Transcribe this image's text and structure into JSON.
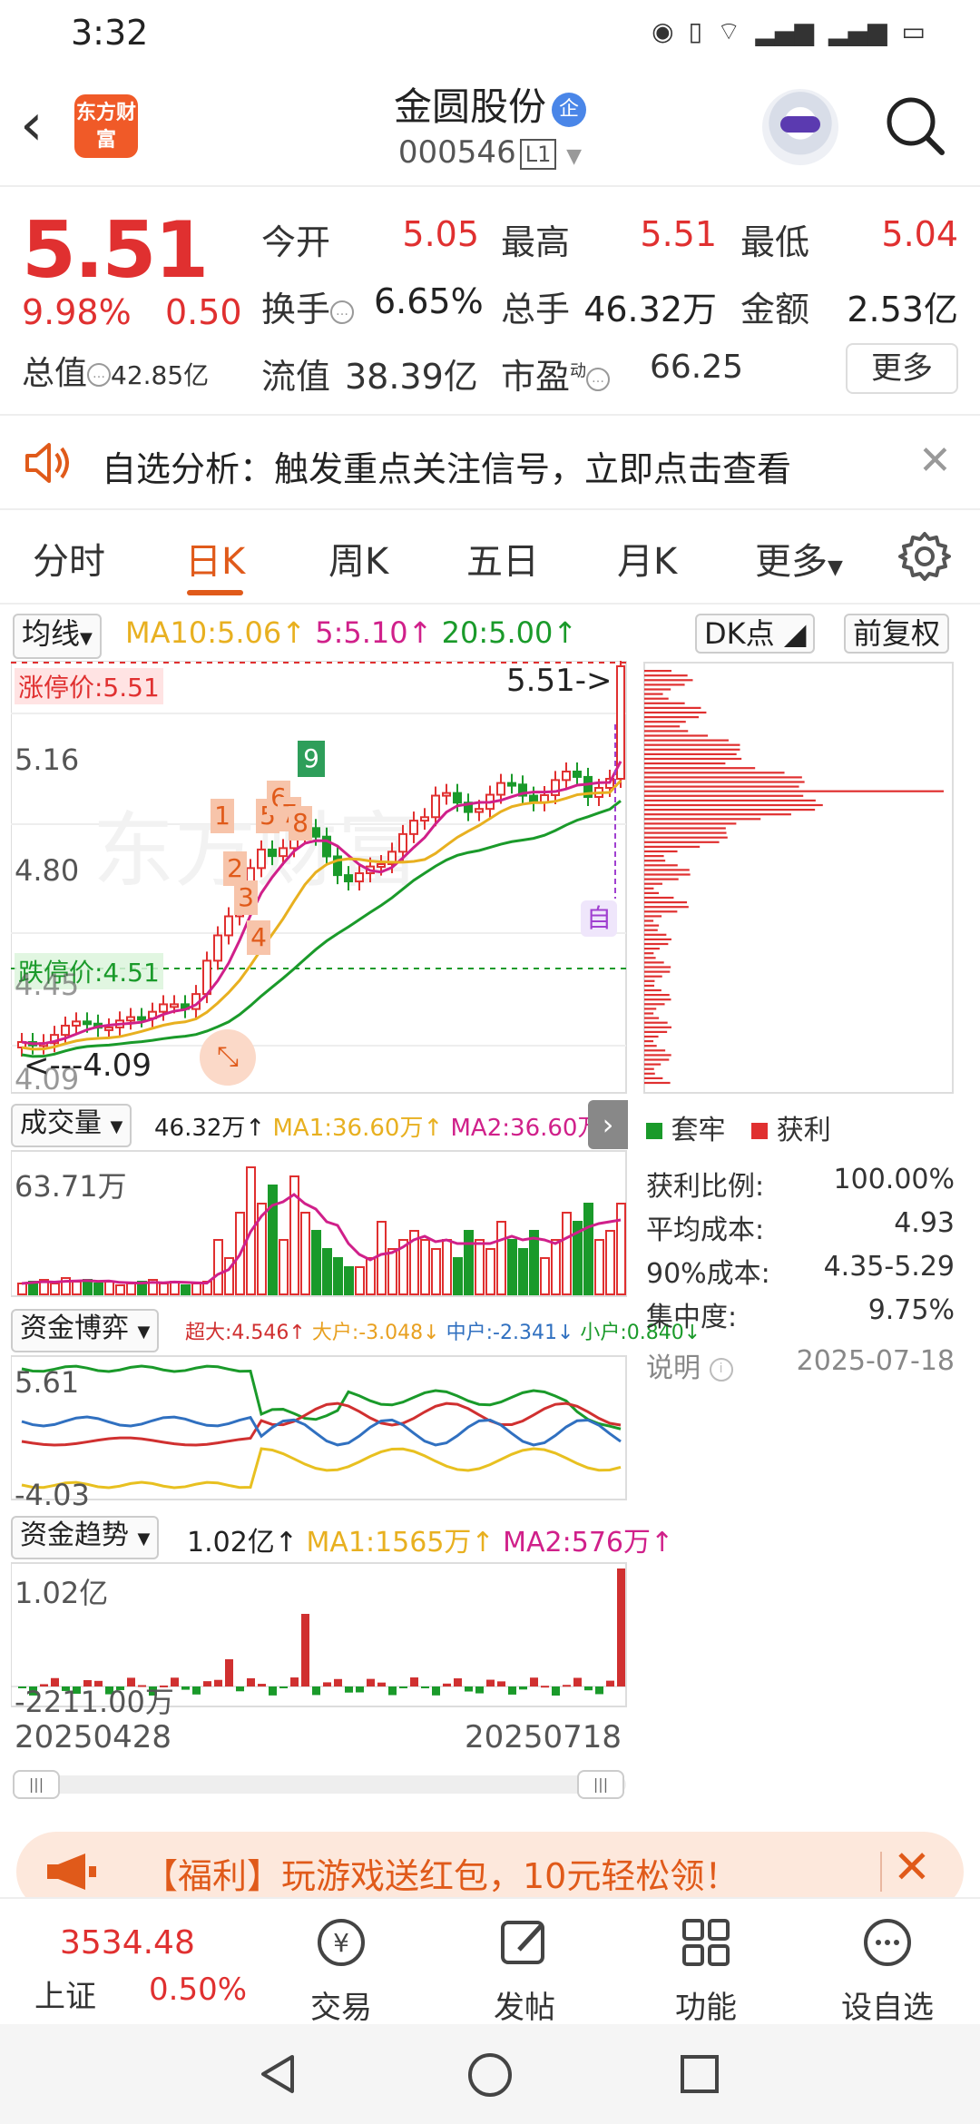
{
  "status": {
    "time": "3:32"
  },
  "header": {
    "title": "金圆股份",
    "badge": "企",
    "code": "000546",
    "code_tag": "L1",
    "logo_text": "东方财富"
  },
  "quote": {
    "price": "5.51",
    "pct": "9.98%",
    "change": "0.50",
    "open_label": "今开",
    "open": "5.05",
    "high_label": "最高",
    "high": "5.51",
    "low_label": "最低",
    "low": "5.04",
    "turnover_label": "换手",
    "turnover": "6.65%",
    "volume_label": "总手",
    "volume": "46.32万",
    "amount_label": "金额",
    "amount": "2.53亿",
    "total_value_label": "总值",
    "total_value": "42.85亿",
    "float_value_label": "流值",
    "float_value": "38.39亿",
    "pe_label": "市盈",
    "pe_sup": "动",
    "pe": "66.25",
    "more_button": "更多"
  },
  "notice": {
    "text": "自选分析：触发重点关注信号，立即点击查看"
  },
  "tabs": [
    "分时",
    "日K",
    "周K",
    "五日",
    "月K",
    "更多"
  ],
  "chart": {
    "ma_button": "均线",
    "ma10": "MA10:5.06↑",
    "ma5": "5:5.10↑",
    "ma20": "20:5.00↑",
    "dk_button": "DK点",
    "adjust_button": "前复权",
    "price_top": "5.51",
    "limit_up": "涨停价:5.51",
    "y_mid1": "5.16",
    "y_mid2": "4.80",
    "y_mid3": "4.45",
    "y_low": "4.09",
    "limit_down": "跌停价:4.51",
    "last_arrow": "5.51->",
    "low_arrow": "<---4.09",
    "zi": "自",
    "signals": [
      "1",
      "2",
      "3",
      "4",
      "5",
      "6",
      "7",
      "8",
      "9"
    ],
    "volume_button": "成交量",
    "vol_value": "46.32万↑",
    "vol_ma1": "MA1:36.60万↑",
    "vol_ma2": "MA2:36.60万↑",
    "vol_max": "63.71万",
    "fund_button": "资金博弈",
    "fund_super": "超大:4.546↑",
    "fund_big": "大户:-3.048↓",
    "fund_mid": "中户:-2.341↓",
    "fund_small": "小户:0.840↓",
    "fund_top": "5.61",
    "fund_bottom": "-4.03",
    "trend_button": "资金趋势",
    "trend_value": "1.02亿↑",
    "trend_ma1": "MA1:1565万↑",
    "trend_ma2": "MA2:576万↑",
    "trend_top": "1.02亿",
    "trend_bottom": "-2211.00万",
    "date_start": "20250428",
    "date_end": "20250718"
  },
  "chip": {
    "legend_trapped": "套牢",
    "legend_profit": "获利",
    "rows": [
      {
        "label": "获利比例:",
        "value": "100.00%"
      },
      {
        "label": "平均成本:",
        "value": "4.93"
      },
      {
        "label": "90%成本:",
        "value": "4.35-5.29"
      },
      {
        "label": "集中度:",
        "value": "9.75%"
      }
    ],
    "note": "说明",
    "date": "2025-07-18"
  },
  "banner": {
    "text": "【福利】玩游戏送红包，10元轻松领！"
  },
  "bottom": {
    "index_value": "3534.48",
    "index_name": "上证",
    "index_pct": "0.50%",
    "trade": "交易",
    "post": "发帖",
    "func": "功能",
    "watch": "设自选"
  },
  "colors": {
    "up": "#e03030",
    "down": "#1a9a2a",
    "accent": "#e05a1a",
    "ma5": "#d0208a",
    "ma10": "#e8b020",
    "ma20": "#1a9a2a"
  }
}
